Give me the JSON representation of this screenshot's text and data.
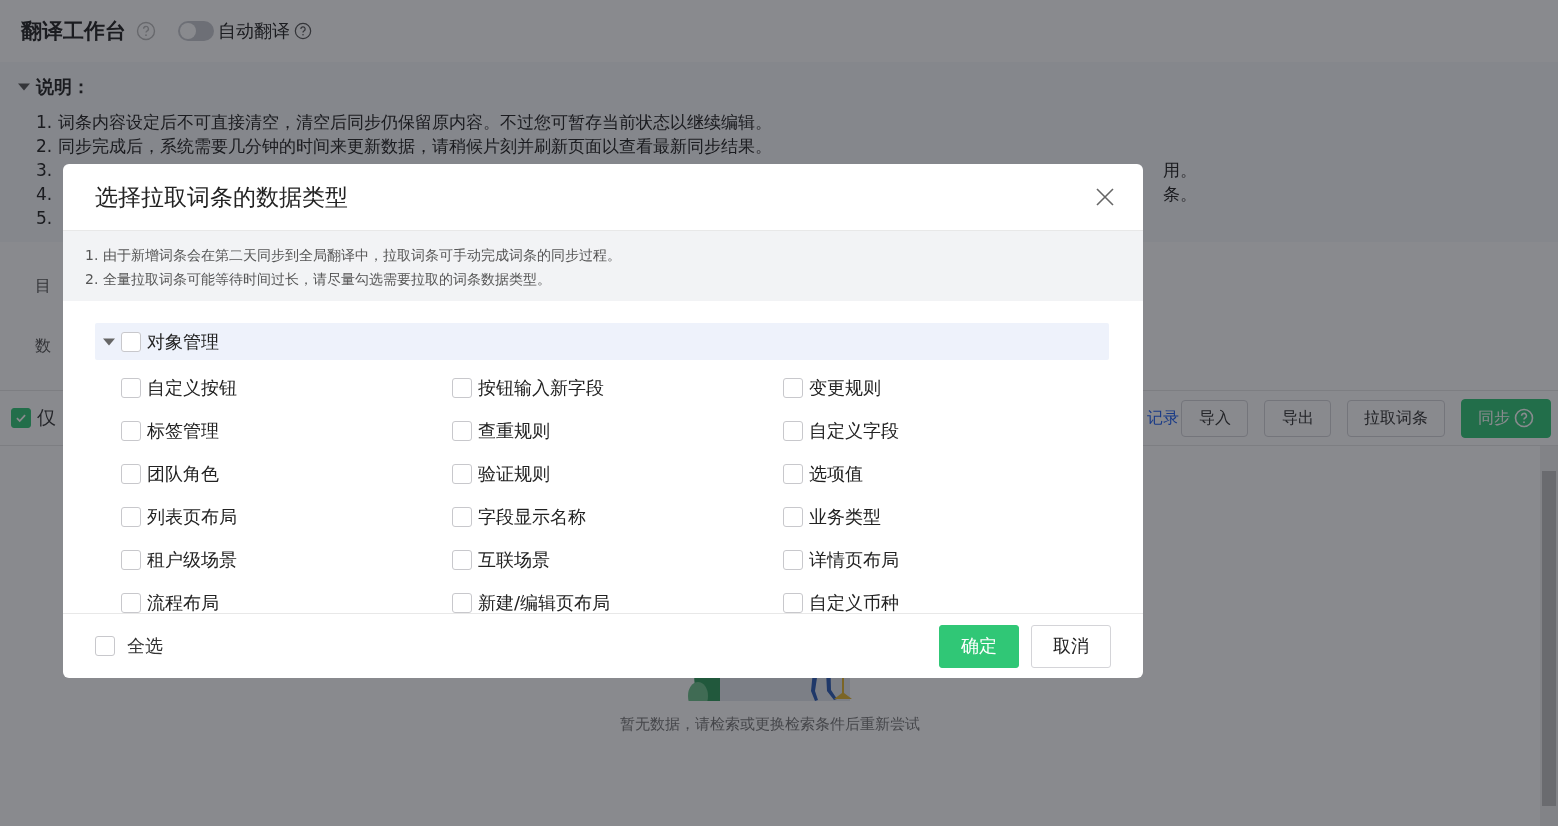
{
  "page": {
    "title": "翻译工作台",
    "auto_translate": {
      "label": "自动翻译",
      "on": false
    }
  },
  "notes": {
    "heading": "说明：",
    "expanded": true,
    "lines": [
      {
        "start": "1. 词条内容设定后不可直接清空，清空后同步仍保留原内容。不过您可暂存当前状态以继续编辑。"
      },
      {
        "start": "2. 同步完成后，系统需要几分钟的时间来更新数据，请稍候片刻并刷新页面以查看最新同步结果。"
      },
      {
        "start": "3.",
        "end": "用。"
      },
      {
        "start": "4.",
        "end": "条。"
      },
      {
        "start": "5."
      }
    ]
  },
  "filters": [
    {
      "label": "目"
    },
    {
      "label": "数"
    }
  ],
  "only_shown": {
    "label": "仅",
    "checked": true
  },
  "toolbar": {
    "link": "记录",
    "buttons": [
      "导入",
      "导出",
      "拉取词条"
    ],
    "primary": "同步"
  },
  "empty_text": "暂无数据，请检索或更换检索条件后重新尝试",
  "modal": {
    "title": "选择拉取词条的数据类型",
    "notices": [
      "1. 由于新增词条会在第二天同步到全局翻译中，拉取词条可手动完成词条的同步过程。",
      "2. 全量拉取词条可能等待时间过长，请尽量勾选需要拉取的词条数据类型。"
    ],
    "group": {
      "label": "对象管理",
      "expanded": true,
      "checked": false,
      "items": [
        {
          "label": "自定义按钮",
          "checked": false
        },
        {
          "label": "按钮输入新字段",
          "checked": false
        },
        {
          "label": "变更规则",
          "checked": false
        },
        {
          "label": "标签管理",
          "checked": false
        },
        {
          "label": "查重规则",
          "checked": false
        },
        {
          "label": "自定义字段",
          "checked": false
        },
        {
          "label": "团队角色",
          "checked": false
        },
        {
          "label": "验证规则",
          "checked": false
        },
        {
          "label": "选项值",
          "checked": false
        },
        {
          "label": "列表页布局",
          "checked": false
        },
        {
          "label": "字段显示名称",
          "checked": false
        },
        {
          "label": "业务类型",
          "checked": false
        },
        {
          "label": "租户级场景",
          "checked": false
        },
        {
          "label": "互联场景",
          "checked": false
        },
        {
          "label": "详情页布局",
          "checked": false
        },
        {
          "label": "流程布局",
          "checked": false
        },
        {
          "label": "新建/编辑页布局",
          "checked": false
        },
        {
          "label": "自定义币种",
          "checked": false
        }
      ]
    },
    "select_all": {
      "label": "全选",
      "checked": false
    },
    "confirm": "确定",
    "cancel": "取消"
  }
}
